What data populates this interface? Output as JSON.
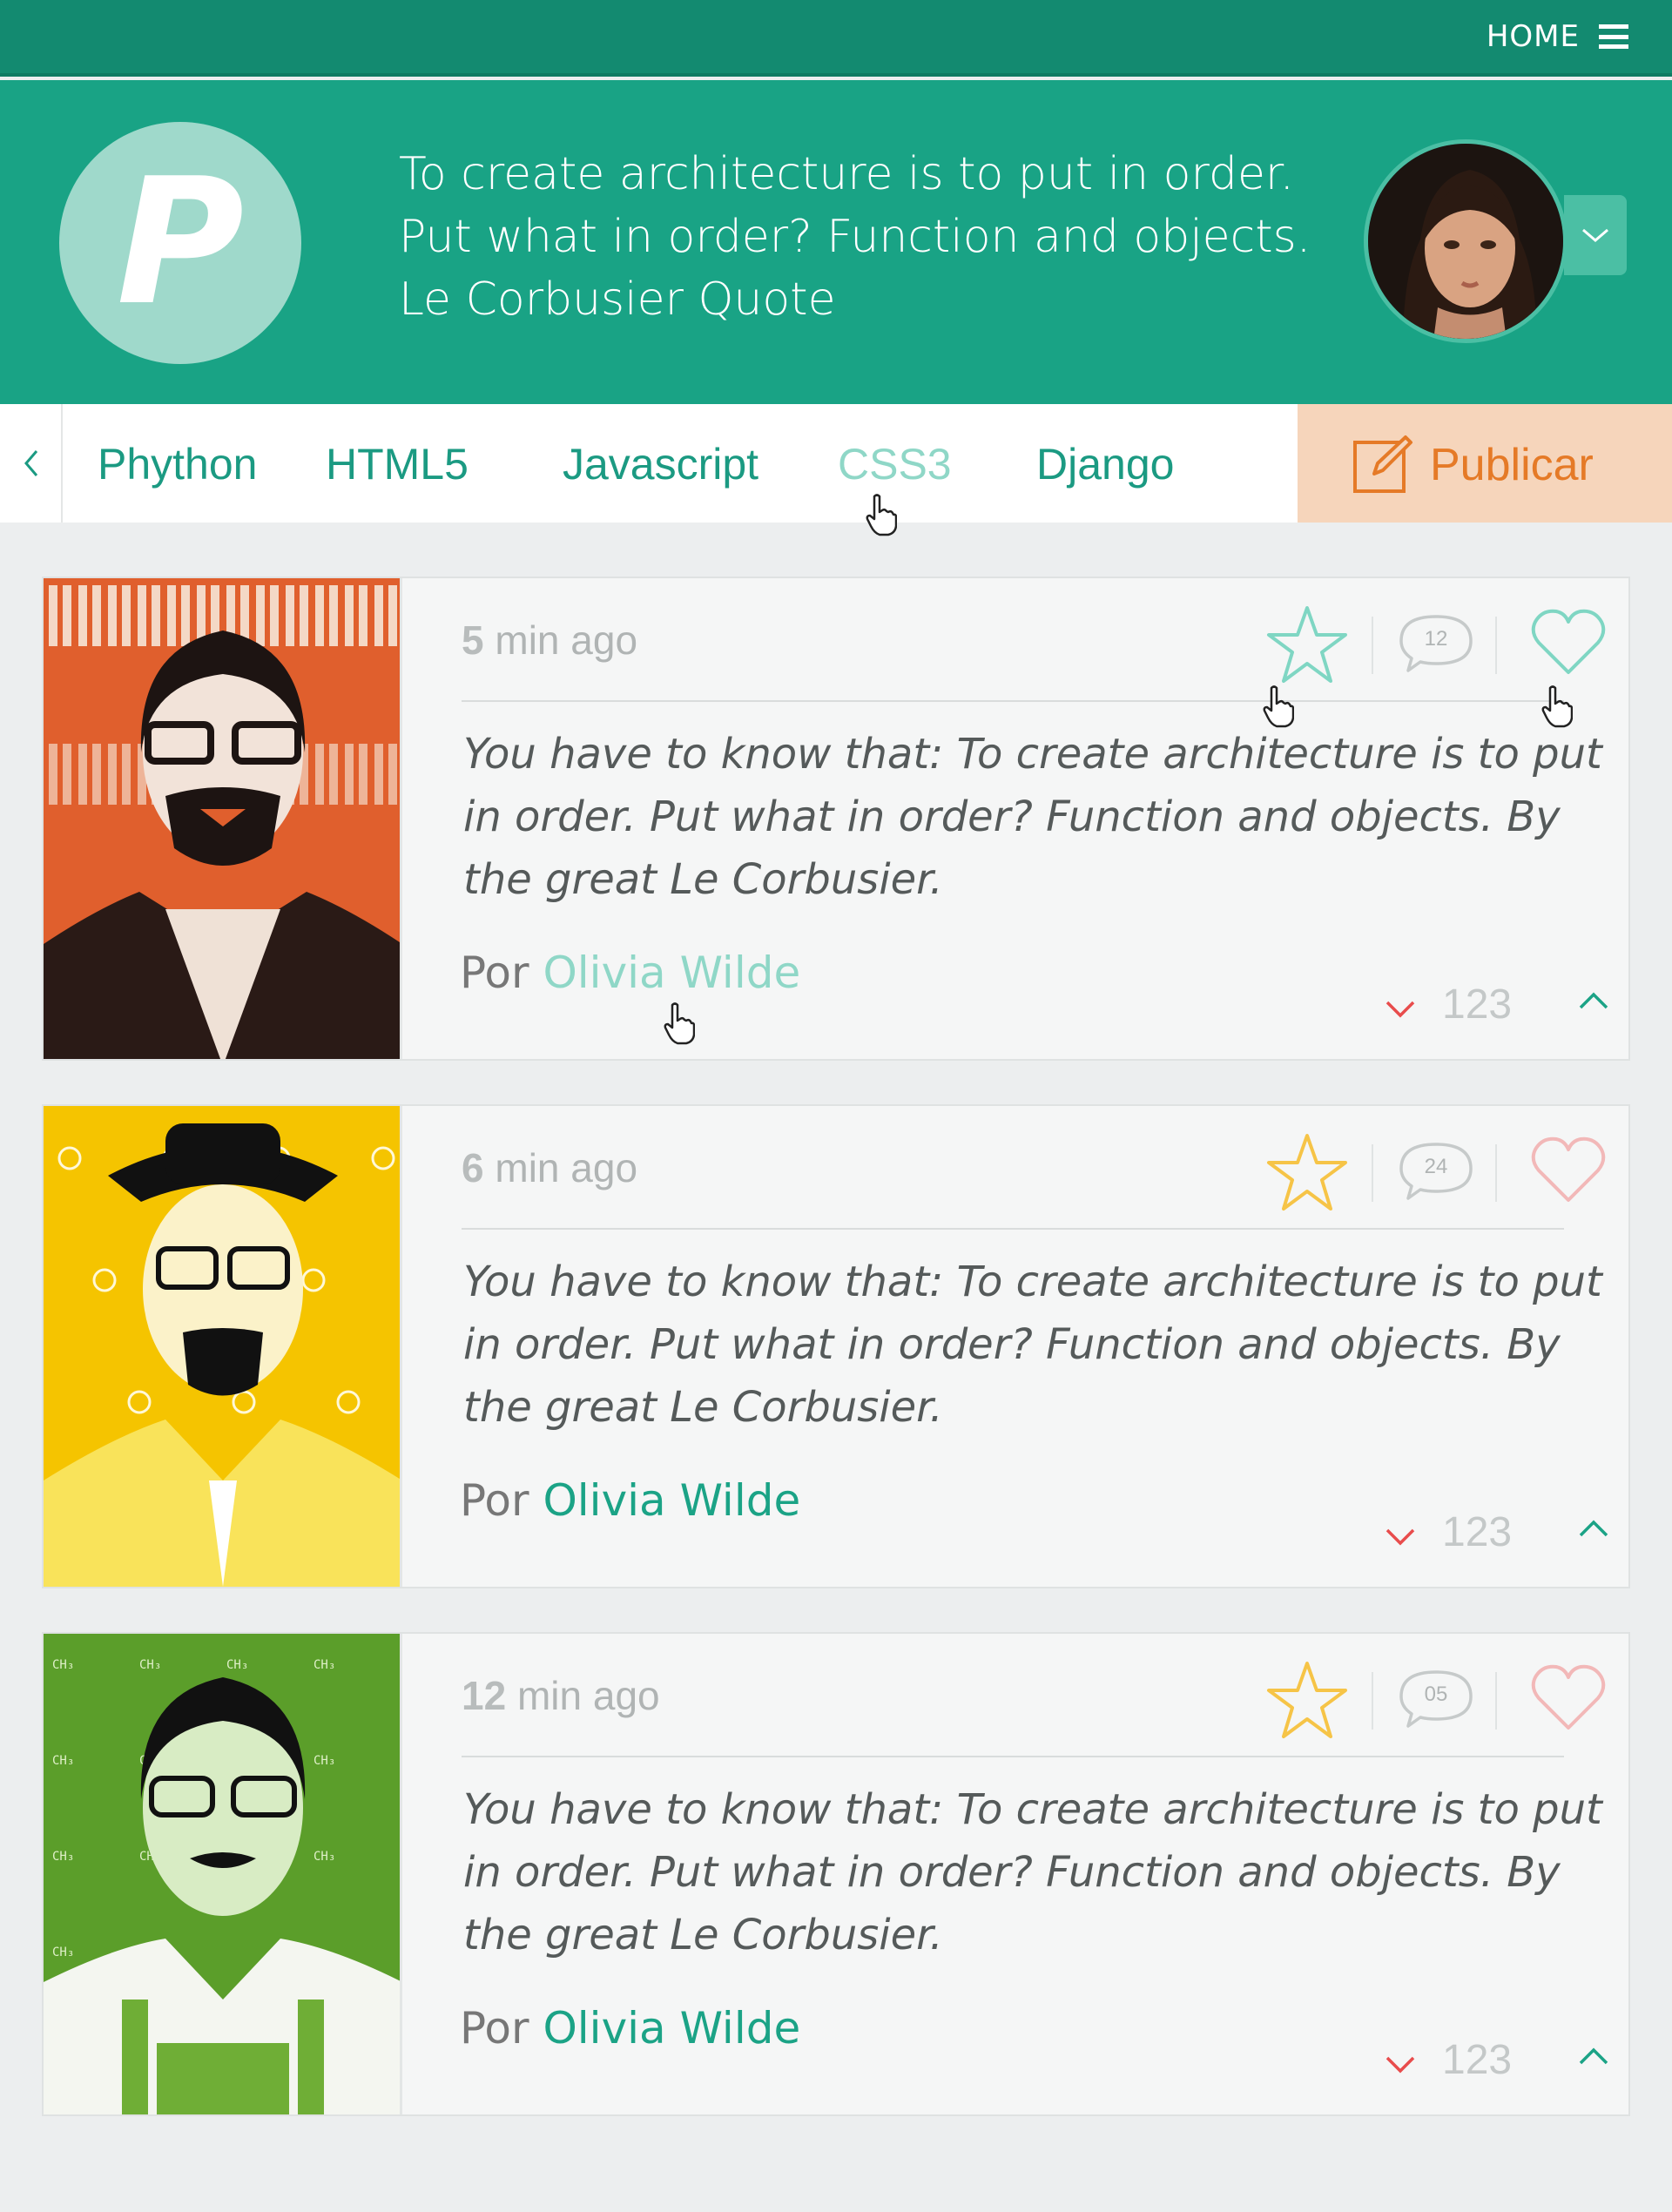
{
  "topbar": {
    "home_label": "HOME"
  },
  "header": {
    "logo_letter": "P",
    "quote_lines": [
      "To create architecture is to put in order.",
      "Put what in order? Function and objects.",
      "Le Corbusier Quote"
    ]
  },
  "nav": {
    "items": [
      "Phython",
      "HTML5",
      "Javascript",
      "CSS3",
      "Django"
    ],
    "active": "CSS3",
    "publish_label": "Publicar"
  },
  "posts": [
    {
      "time_num": "5",
      "time_unit": "min ago",
      "comments": "12",
      "text_lines": [
        "You have to know that: To create architecture is to put",
        "in order. Put what in order? Function and objects. By",
        "the great Le Corbusier."
      ],
      "by": "Por",
      "author": "Olivia Wilde",
      "votes": "123",
      "star_color": "#7fd6c3",
      "heart_color": "#7fd6c3"
    },
    {
      "time_num": "6",
      "time_unit": "min ago",
      "comments": "24",
      "text_lines": [
        "You have to know that: To create architecture is to put",
        "in order. Put what in order? Function and objects. By",
        "the great Le Corbusier."
      ],
      "by": "Por",
      "author": "Olivia Wilde",
      "votes": "123",
      "star_color": "#f6c447",
      "heart_color": "#f2b8b8"
    },
    {
      "time_num": "12",
      "time_unit": "min ago",
      "comments": "05",
      "text_lines": [
        "You have to know that: To create architecture is to put",
        "in order. Put what in order? Function and objects. By",
        "the great Le Corbusier."
      ],
      "by": "Por",
      "author": "Olivia Wilde",
      "votes": "123",
      "star_color": "#f6c447",
      "heart_color": "#f2b8b8"
    }
  ],
  "colors": {
    "topbar": "#138a70",
    "header": "#19a385",
    "accent": "#1ba386",
    "publish_bg": "#f6d5bb",
    "publish_text": "#e57a27",
    "vote_down": "#e84c4c",
    "vote_up": "#1ba386"
  }
}
